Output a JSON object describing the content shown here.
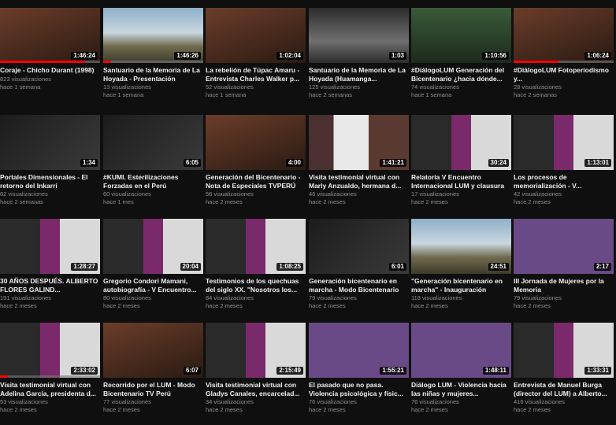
{
  "colors": {
    "background": "#0f0f0f",
    "progress": "#ff0000",
    "meta_text": "#8f8f8f"
  },
  "videos": [
    {
      "title": "Coraje - Chicho Durant (1998)",
      "views": "823 visualizaciones",
      "age": "hace 1 semana",
      "duration": "1:46:24",
      "thumb": "t-warm",
      "watched": 0.85
    },
    {
      "title": "Santuario de la Memoria de La Hoyada - Presentación",
      "views": "13 visualizaciones",
      "age": "hace 1 semana",
      "duration": "1:46:26",
      "thumb": "t-sky",
      "watched": 0.08
    },
    {
      "title": "La rebelión de Túpac Amaru - Entrevista Charles Walker p...",
      "views": "52 visualizaciones",
      "age": "hace 1 semana",
      "duration": "1:02:04",
      "thumb": "t-warm",
      "watched": 0.0
    },
    {
      "title": "Santuario de la Memoria de La Hoyada (Huamanga...",
      "views": "125 visualizaciones",
      "age": "hace 2 semanas",
      "duration": "1:03",
      "thumb": "t-bw",
      "watched": 0.0
    },
    {
      "title": "#DiálogoLUM Generación del Bicentenario ¿hacia dónde...",
      "views": "74 visualizaciones",
      "age": "hace 1 semana",
      "duration": "1:10:56",
      "thumb": "t-green",
      "watched": 0.0
    },
    {
      "title": "#DiálogoLUM Fotoperiodismo y...",
      "views": "28 visualizaciones",
      "age": "hace 2 semanas",
      "duration": "1:06:24",
      "thumb": "t-warm",
      "watched": 0.45
    },
    {
      "title": "Portales Dimensionales - El retorno del Inkarri",
      "views": "62 visualizaciones",
      "age": "hace 2 semanas",
      "duration": "1:34",
      "thumb": "t-dark",
      "watched": 0.0
    },
    {
      "title": "#KUMI. Esterilizaciones Forzadas en el Perú",
      "views": "60 visualizaciones",
      "age": "hace 1 mes",
      "duration": "6:05",
      "thumb": "t-dark",
      "watched": 0.0
    },
    {
      "title": "Generación del Bicentenario - Nota de Especiales TVPERÚ",
      "views": "56 visualizaciones",
      "age": "hace 2 meses",
      "duration": "4:00",
      "thumb": "t-warm",
      "watched": 0.0
    },
    {
      "title": "Visita testimonial virtual con Marly Anzualdo, hermana d...",
      "views": "46 visualizaciones",
      "age": "hace 2 meses",
      "duration": "1:41:21",
      "thumb": "t-room",
      "watched": 0.0
    },
    {
      "title": "Relatoría V Encuentro Internacional LUM y clausura",
      "views": "17 visualizaciones",
      "age": "hace 2 meses",
      "duration": "30:24",
      "thumb": "t-magenta",
      "watched": 0.0
    },
    {
      "title": "Los procesos de memorialización - V...",
      "views": "42 visualizaciones",
      "age": "hace 2 meses",
      "duration": "1:13:01",
      "thumb": "t-magenta",
      "watched": 0.0
    },
    {
      "title": "30 AÑOS DESPUÉS. ALBERTO FLORES GALIND...",
      "views": "191 visualizaciones",
      "age": "hace 2 meses",
      "duration": "1:28:27",
      "thumb": "t-magenta",
      "watched": 0.0
    },
    {
      "title": "Gregorio Condori Mamani, autobiografía - V Encuentro...",
      "views": "80 visualizaciones",
      "age": "hace 2 meses",
      "duration": "20:04",
      "thumb": "t-magenta",
      "watched": 0.0
    },
    {
      "title": "Testimonios de los quechuas del siglo XX. \"Nosotros los...",
      "views": "84 visualizaciones",
      "age": "hace 2 meses",
      "duration": "1:08:25",
      "thumb": "t-magenta",
      "watched": 0.0
    },
    {
      "title": "Generación bicentenario en marcha - Modo Bicentenario",
      "views": "79 visualizaciones",
      "age": "hace 2 meses",
      "duration": "6:01",
      "thumb": "t-dark",
      "watched": 0.0
    },
    {
      "title": "\"Generación bicentenario en marcha\" - Inauguración",
      "views": "118 visualizaciones",
      "age": "hace 2 meses",
      "duration": "24:51",
      "thumb": "t-sky",
      "watched": 0.0
    },
    {
      "title": "III Jornada de Mujeres por la Memoria",
      "views": "79 visualizaciones",
      "age": "hace 2 meses",
      "duration": "2:17",
      "thumb": "t-purple",
      "watched": 0.0
    },
    {
      "title": "Visita testimonial virtual con Adelina García, presidenta d...",
      "views": "53 visualizaciones",
      "age": "hace 2 meses",
      "duration": "2:33:02",
      "thumb": "t-magenta",
      "watched": 0.08
    },
    {
      "title": "Recorrido por el LUM - Modo Bicentenario TV Perú",
      "views": "77 visualizaciones",
      "age": "hace 2 meses",
      "duration": "6:07",
      "thumb": "t-warm",
      "watched": 0.0
    },
    {
      "title": "Visita testimonial virtual con Gladys Canales, encarcelad...",
      "views": "34 visualizaciones",
      "age": "hace 2 meses",
      "duration": "2:15:49",
      "thumb": "t-magenta",
      "watched": 0.0
    },
    {
      "title": "El pasado que no pasa. Violencia psicológica y físic...",
      "views": "76 visualizaciones",
      "age": "hace 2 meses",
      "duration": "1:55:21",
      "thumb": "t-purple",
      "watched": 0.0
    },
    {
      "title": "Diálogo LUM - Violencia hacia las niñas y mujeres...",
      "views": "76 visualizaciones",
      "age": "hace 2 meses",
      "duration": "1:48:11",
      "thumb": "t-purple",
      "watched": 0.0
    },
    {
      "title": "Entrevista de Manuel Burga (director del LUM) a Alberto...",
      "views": "416 visualizaciones",
      "age": "hace 2 meses",
      "duration": "1:33:31",
      "thumb": "t-magenta",
      "watched": 0.0
    }
  ]
}
